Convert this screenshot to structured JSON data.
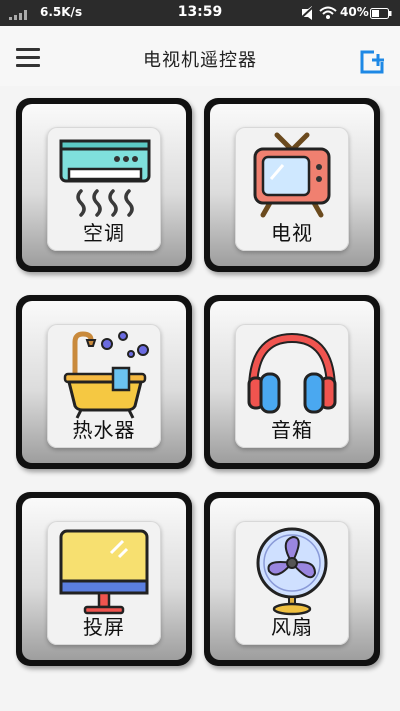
{
  "status_bar": {
    "network_speed": "6.5K/s",
    "time": "13:59",
    "battery_percent": "40%"
  },
  "header": {
    "title": "电视机遥控器",
    "menu_icon": "hamburger-menu-icon",
    "add_icon": "add-device-icon"
  },
  "devices": [
    {
      "label": "空调",
      "icon": "air-conditioner-icon"
    },
    {
      "label": "电视",
      "icon": "television-icon"
    },
    {
      "label": "热水器",
      "icon": "water-heater-icon"
    },
    {
      "label": "音箱",
      "icon": "headphones-speaker-icon"
    },
    {
      "label": "投屏",
      "icon": "monitor-cast-icon"
    },
    {
      "label": "风扇",
      "icon": "fan-icon"
    }
  ],
  "colors": {
    "status_bar_bg": "#2b2b2b",
    "accent_blue": "#1e88e5",
    "tile_border": "#111111"
  }
}
